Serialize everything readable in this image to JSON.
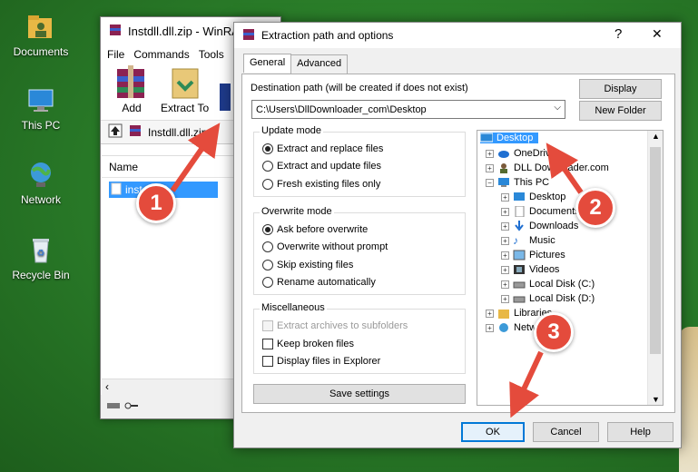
{
  "desktop": {
    "icons": [
      "Documents",
      "This PC",
      "Network",
      "Recycle Bin"
    ]
  },
  "winrar": {
    "title": "Instdll.dll.zip - WinRAR",
    "menu": [
      "File",
      "Commands",
      "Tools"
    ],
    "toolbar": {
      "add": "Add",
      "extract_to": "Extract To"
    },
    "address": "Instdll.dll.zip",
    "column_name": "Name",
    "file_row": "instdll.dll"
  },
  "dialog": {
    "title": "Extraction path and options",
    "help": "?",
    "close": "✕",
    "tabs": [
      "General",
      "Advanced"
    ],
    "dest_label": "Destination path (will be created if does not exist)",
    "dest_value": "C:\\Users\\DllDownloader_com\\Desktop",
    "btn_display": "Display",
    "btn_new_folder": "New Folder",
    "update_mode": {
      "label": "Update mode",
      "options": [
        "Extract and replace files",
        "Extract and update files",
        "Fresh existing files only"
      ],
      "selected": 0
    },
    "overwrite_mode": {
      "label": "Overwrite mode",
      "options": [
        "Ask before overwrite",
        "Overwrite without prompt",
        "Skip existing files",
        "Rename automatically"
      ],
      "selected": 0
    },
    "misc": {
      "label": "Miscellaneous",
      "options": [
        "Extract archives to subfolders",
        "Keep broken files",
        "Display files in Explorer"
      ]
    },
    "save_settings": "Save settings",
    "tree": [
      "Desktop",
      "OneDrive",
      "DLL Downloader.com",
      "This PC",
      "Desktop",
      "Documents",
      "Downloads",
      "Music",
      "Pictures",
      "Videos",
      "Local Disk (C:)",
      "Local Disk (D:)",
      "Libraries",
      "Network"
    ],
    "ok": "OK",
    "cancel": "Cancel",
    "help_btn": "Help"
  },
  "callouts": [
    "1",
    "2",
    "3"
  ],
  "colors": {
    "accent": "#0078d7",
    "callout": "#e44b3c",
    "selection": "#3399ff"
  }
}
